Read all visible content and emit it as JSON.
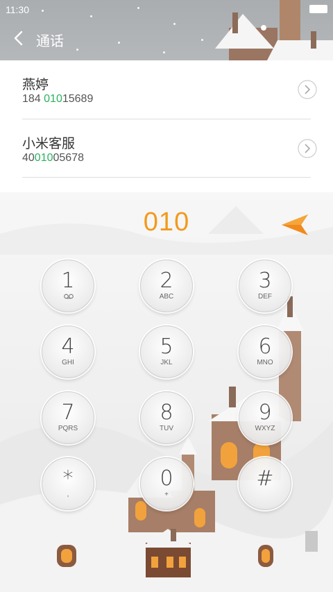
{
  "status_bar": {
    "time": "11:30"
  },
  "header": {
    "title": "通话"
  },
  "contacts": [
    {
      "name": "燕婷",
      "number_pre": "184 ",
      "number_match": "010",
      "number_post": "15689"
    },
    {
      "name": "小米客服",
      "number_pre": "40",
      "number_match": "010",
      "number_post": "05678"
    }
  ],
  "dialer": {
    "display": "010",
    "keys": [
      {
        "digit": "1",
        "letters": ""
      },
      {
        "digit": "2",
        "letters": "ABC"
      },
      {
        "digit": "3",
        "letters": "DEF"
      },
      {
        "digit": "4",
        "letters": "GHI"
      },
      {
        "digit": "5",
        "letters": "JKL"
      },
      {
        "digit": "6",
        "letters": "MNO"
      },
      {
        "digit": "7",
        "letters": "PQRS"
      },
      {
        "digit": "8",
        "letters": "TUV"
      },
      {
        "digit": "9",
        "letters": "WXYZ"
      },
      {
        "digit": "*",
        "letters": ","
      },
      {
        "digit": "0",
        "letters": "+"
      },
      {
        "digit": "#",
        "letters": ""
      }
    ]
  },
  "colors": {
    "match_highlight": "#28b35f",
    "dial_text": "#f29a1c",
    "header_bg": "#b0b3b5"
  },
  "icons": {
    "back": "chevron-left-icon",
    "row_detail": "chevron-right-icon",
    "backspace": "backspace-arrow-icon",
    "voicemail": "voicemail-icon"
  }
}
